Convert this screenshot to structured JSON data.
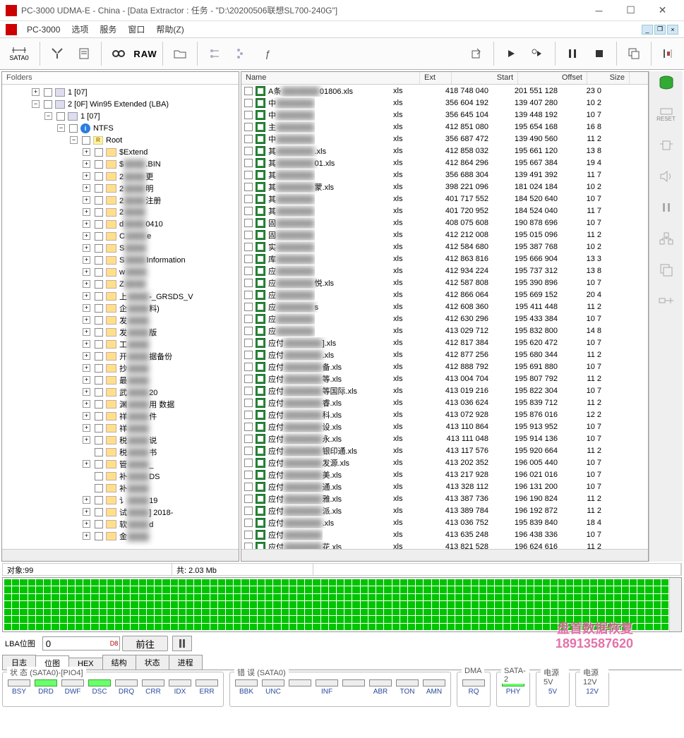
{
  "title": "PC-3000 UDMA-E - China - [Data Extractor : 任务 - \"D:\\20200506联想SL700-240G\"]",
  "menu": {
    "app": "PC-3000",
    "opts": "选项",
    "svc": "服务",
    "win": "窗口",
    "help": "帮助(Z)"
  },
  "toolbar": {
    "sata": "SATA0",
    "raw": "RAW"
  },
  "folders_label": "Folders",
  "sidetool": {
    "reset": "RESET"
  },
  "tree": [
    {
      "indent": 40,
      "exp": "+",
      "type": "disk",
      "label": "1 [07]"
    },
    {
      "indent": 40,
      "exp": "−",
      "type": "disk",
      "label": "2 [0F] Win95 Extended  (LBA)"
    },
    {
      "indent": 58,
      "exp": "−",
      "type": "disk",
      "label": "1 [07]"
    },
    {
      "indent": 76,
      "exp": "−",
      "type": "ntfs",
      "label": "NTFS"
    },
    {
      "indent": 94,
      "exp": "−",
      "type": "root",
      "label": "Root"
    },
    {
      "indent": 112,
      "exp": "+",
      "type": "f",
      "label": "$Extend"
    },
    {
      "indent": 112,
      "exp": "+",
      "type": "f",
      "label": "$",
      "blur": ".BIN"
    },
    {
      "indent": 112,
      "exp": "+",
      "type": "f",
      "label": "2",
      "blur": "更"
    },
    {
      "indent": 112,
      "exp": "+",
      "type": "f",
      "label": "2",
      "blur": "明"
    },
    {
      "indent": 112,
      "exp": "+",
      "type": "f",
      "label": "2",
      "blur": "注册"
    },
    {
      "indent": 112,
      "exp": "+",
      "type": "f",
      "label": "2",
      "blur": ""
    },
    {
      "indent": 112,
      "exp": "+",
      "type": "f",
      "label": "d",
      "blur": "0410"
    },
    {
      "indent": 112,
      "exp": "+",
      "type": "f",
      "label": "C",
      "blur": "e"
    },
    {
      "indent": 112,
      "exp": "+",
      "type": "f",
      "label": "S",
      "blur": ""
    },
    {
      "indent": 112,
      "exp": "+",
      "type": "f",
      "label": "S",
      "blur": "Information"
    },
    {
      "indent": 112,
      "exp": "+",
      "type": "f",
      "label": "w",
      "blur": ""
    },
    {
      "indent": 112,
      "exp": "+",
      "type": "f",
      "label": "Z",
      "blur": ""
    },
    {
      "indent": 112,
      "exp": "+",
      "type": "f",
      "label": "上",
      "blur": "-_GRSDS_V"
    },
    {
      "indent": 112,
      "exp": "+",
      "type": "f",
      "label": "企",
      "blur": "料)"
    },
    {
      "indent": 112,
      "exp": "+",
      "type": "f",
      "label": "发",
      "blur": ""
    },
    {
      "indent": 112,
      "exp": "+",
      "type": "f",
      "label": "发",
      "blur": "版"
    },
    {
      "indent": 112,
      "exp": "+",
      "type": "f",
      "label": "工",
      "blur": ""
    },
    {
      "indent": 112,
      "exp": "+",
      "type": "f",
      "label": "开",
      "blur": "据备份"
    },
    {
      "indent": 112,
      "exp": "+",
      "type": "f",
      "label": "抄",
      "blur": ""
    },
    {
      "indent": 112,
      "exp": "+",
      "type": "f",
      "label": "最",
      "blur": ""
    },
    {
      "indent": 112,
      "exp": "+",
      "type": "f",
      "label": "武",
      "blur": "20"
    },
    {
      "indent": 112,
      "exp": "+",
      "type": "f",
      "label": "渊",
      "blur": "用    数据"
    },
    {
      "indent": 112,
      "exp": "+",
      "type": "f",
      "label": "祥",
      "blur": "件"
    },
    {
      "indent": 112,
      "exp": "+",
      "type": "f",
      "label": "祥",
      "blur": ""
    },
    {
      "indent": 112,
      "exp": "+",
      "type": "f",
      "label": "税",
      "blur": "说"
    },
    {
      "indent": 112,
      "exp": "",
      "type": "f",
      "label": "税",
      "blur": "书"
    },
    {
      "indent": 112,
      "exp": "+",
      "type": "f",
      "label": "管",
      "blur": "_"
    },
    {
      "indent": 112,
      "exp": "",
      "type": "f",
      "label": "补",
      "blur": "DS"
    },
    {
      "indent": 112,
      "exp": "",
      "type": "f",
      "label": "补",
      "blur": ""
    },
    {
      "indent": 112,
      "exp": "+",
      "type": "f",
      "label": "讠",
      "blur": "19"
    },
    {
      "indent": 112,
      "exp": "+",
      "type": "f",
      "label": "试",
      "blur": "] 2018-"
    },
    {
      "indent": 112,
      "exp": "+",
      "type": "f",
      "label": "软",
      "blur": "d"
    },
    {
      "indent": 112,
      "exp": "+",
      "type": "f",
      "label": "金",
      "blur": ""
    }
  ],
  "grid": {
    "headers": {
      "name": "Name",
      "ext": "Ext",
      "start": "Start",
      "offset": "Offset",
      "size": "Size"
    },
    "rows": [
      {
        "name": "A条",
        "blur": "20",
        "suffix": "01806.xls",
        "ext": "xls",
        "start": "418 748 040",
        "offset": "201 551 128",
        "size": "23 0"
      },
      {
        "name": "中",
        "blur": "",
        "suffix": "",
        "ext": "xls",
        "start": "356 604 192",
        "offset": "139 407 280",
        "size": "10 2"
      },
      {
        "name": "中",
        "blur": "",
        "suffix": "",
        "ext": "xls",
        "start": "356 645 104",
        "offset": "139 448 192",
        "size": "10 7"
      },
      {
        "name": "主",
        "blur": "",
        "suffix": "",
        "ext": "xls",
        "start": "412 851 080",
        "offset": "195 654 168",
        "size": "16 8"
      },
      {
        "name": "中",
        "blur": "",
        "suffix": "",
        "ext": "xls",
        "start": "356 687 472",
        "offset": "139 490 560",
        "size": "11 2"
      },
      {
        "name": "其",
        "blur": "",
        "suffix": ".xls",
        "ext": "xls",
        "start": "412 858 032",
        "offset": "195 661 120",
        "size": "13 8"
      },
      {
        "name": "其",
        "blur": "",
        "suffix": "01.xls",
        "ext": "xls",
        "start": "412 864 296",
        "offset": "195 667 384",
        "size": "19 4"
      },
      {
        "name": "其",
        "blur": "",
        "suffix": "",
        "ext": "xls",
        "start": "356 688 304",
        "offset": "139 491 392",
        "size": "11 7"
      },
      {
        "name": "其",
        "blur": "",
        "suffix": "蒙.xls",
        "ext": "xls",
        "start": "398 221 096",
        "offset": "181 024 184",
        "size": "10 2"
      },
      {
        "name": "其",
        "blur": "",
        "suffix": "",
        "ext": "xls",
        "start": "401 717 552",
        "offset": "184 520 640",
        "size": "10 7"
      },
      {
        "name": "其",
        "blur": "",
        "suffix": "",
        "ext": "xls",
        "start": "401 720 952",
        "offset": "184 524 040",
        "size": "11 7"
      },
      {
        "name": "固",
        "blur": "",
        "suffix": "",
        "ext": "xls",
        "start": "408 075 608",
        "offset": "190 878 696",
        "size": "10 7"
      },
      {
        "name": "固",
        "blur": "",
        "suffix": "",
        "ext": "xls",
        "start": "412 212 008",
        "offset": "195 015 096",
        "size": "11 2"
      },
      {
        "name": "实",
        "blur": "",
        "suffix": "",
        "ext": "xls",
        "start": "412 584 680",
        "offset": "195 387 768",
        "size": "10 2"
      },
      {
        "name": "库",
        "blur": "",
        "suffix": "",
        "ext": "xls",
        "start": "412 863 816",
        "offset": "195 666 904",
        "size": "13 3"
      },
      {
        "name": "应",
        "blur": "",
        "suffix": "",
        "ext": "xls",
        "start": "412 934 224",
        "offset": "195 737 312",
        "size": "13 8"
      },
      {
        "name": "应",
        "blur": "",
        "suffix": "悦.xls",
        "ext": "xls",
        "start": "412 587 808",
        "offset": "195 390 896",
        "size": "10 7"
      },
      {
        "name": "应",
        "blur": "",
        "suffix": "",
        "ext": "xls",
        "start": "412 866 064",
        "offset": "195 669 152",
        "size": "20 4"
      },
      {
        "name": "应",
        "blur": "",
        "suffix": "s",
        "ext": "xls",
        "start": "412 608 360",
        "offset": "195 411 448",
        "size": "11 2"
      },
      {
        "name": "应",
        "blur": "",
        "suffix": "",
        "ext": "xls",
        "start": "412 630 296",
        "offset": "195 433 384",
        "size": "10 7"
      },
      {
        "name": "应",
        "blur": "",
        "suffix": "",
        "ext": "xls",
        "start": "413 029 712",
        "offset": "195 832 800",
        "size": "14 8"
      },
      {
        "name": "应付",
        "blur": "",
        "suffix": "].xls",
        "ext": "xls",
        "start": "412 817 384",
        "offset": "195 620 472",
        "size": "10 7"
      },
      {
        "name": "应付",
        "blur": "",
        "suffix": ".xls",
        "ext": "xls",
        "start": "412 877 256",
        "offset": "195 680 344",
        "size": "11 2"
      },
      {
        "name": "应付",
        "blur": "",
        "suffix": "备.xls",
        "ext": "xls",
        "start": "412 888 792",
        "offset": "195 691 880",
        "size": "10 7"
      },
      {
        "name": "应付",
        "blur": "",
        "suffix": "等.xls",
        "ext": "xls",
        "start": "413 004 704",
        "offset": "195 807 792",
        "size": "11 2"
      },
      {
        "name": "应付",
        "blur": "",
        "suffix": "等国际.xls",
        "ext": "xls",
        "start": "413 019 216",
        "offset": "195 822 304",
        "size": "10 7"
      },
      {
        "name": "应付",
        "blur": "",
        "suffix": "睿.xls",
        "ext": "xls",
        "start": "413 036 624",
        "offset": "195 839 712",
        "size": "11 2"
      },
      {
        "name": "应付",
        "blur": "",
        "suffix": "科.xls",
        "ext": "xls",
        "start": "413 072 928",
        "offset": "195 876 016",
        "size": "12 2"
      },
      {
        "name": "应付",
        "blur": "",
        "suffix": "设.xls",
        "ext": "xls",
        "start": "413 110 864",
        "offset": "195 913 952",
        "size": "10 7"
      },
      {
        "name": "应付",
        "blur": "",
        "suffix": "永.xls",
        "ext": "xls",
        "start": "413 111 048",
        "offset": "195 914 136",
        "size": "10 7"
      },
      {
        "name": "应付",
        "blur": "",
        "suffix": "银印通.xls",
        "ext": "xls",
        "start": "413 117 576",
        "offset": "195 920 664",
        "size": "11 2"
      },
      {
        "name": "应付",
        "blur": "",
        "suffix": "发源.xls",
        "ext": "xls",
        "start": "413 202 352",
        "offset": "196 005 440",
        "size": "10 7"
      },
      {
        "name": "应付",
        "blur": "",
        "suffix": "美.xls",
        "ext": "xls",
        "start": "413 217 928",
        "offset": "196 021 016",
        "size": "10 7"
      },
      {
        "name": "应付",
        "blur": "",
        "suffix": "通.xls",
        "ext": "xls",
        "start": "413 328 112",
        "offset": "196 131 200",
        "size": "10 7"
      },
      {
        "name": "应付",
        "blur": "",
        "suffix": "雅.xls",
        "ext": "xls",
        "start": "413 387 736",
        "offset": "196 190 824",
        "size": "11 2"
      },
      {
        "name": "应付",
        "blur": "",
        "suffix": "派.xls",
        "ext": "xls",
        "start": "413 389 784",
        "offset": "196 192 872",
        "size": "11 2"
      },
      {
        "name": "应付",
        "blur": "",
        "suffix": ".xls",
        "ext": "xls",
        "start": "413 036 752",
        "offset": "195 839 840",
        "size": "18 4"
      },
      {
        "name": "应付",
        "blur": "",
        "suffix": "",
        "ext": "xls",
        "start": "413 635 248",
        "offset": "196 438 336",
        "size": "10 7"
      },
      {
        "name": "应付",
        "blur": "",
        "suffix": "花.xls",
        "ext": "xls",
        "start": "413 821 528",
        "offset": "196 624 616",
        "size": "11 2"
      }
    ]
  },
  "status": {
    "objects": "对象:99",
    "total": "共:  2.03 Mb"
  },
  "lba": {
    "label": "LBA位图",
    "value": "0",
    "go": "前往"
  },
  "tabs2": [
    "日志",
    "位图",
    "HEX",
    "结构",
    "状态",
    "进程"
  ],
  "watermark": {
    "l1": "盘首数据恢复",
    "l2": "18913587620"
  },
  "groups": {
    "status": {
      "label": "状 态 (SATA0)-[PIO4]",
      "leds": [
        "BSY",
        "DRD",
        "DWF",
        "DSC",
        "DRQ",
        "CRR",
        "IDX",
        "ERR"
      ],
      "on": [
        1,
        3
      ]
    },
    "error": {
      "label": "错 误 (SATA0)",
      "leds": [
        "BBK",
        "UNC",
        "",
        "INF",
        "",
        "ABR",
        "TON",
        "AMN"
      ]
    },
    "dma": {
      "label": "DMA",
      "leds": [
        "RQ"
      ]
    },
    "sata": {
      "label": "SATA-2",
      "leds": [
        "PHY"
      ],
      "on": [
        0
      ]
    },
    "pwr5": {
      "label": "电源 5V",
      "leds": [
        "5V"
      ],
      "on": [
        0
      ]
    },
    "pwr12": {
      "label": "电源 12V",
      "leds": [
        "12V"
      ],
      "on": [
        0
      ]
    }
  }
}
